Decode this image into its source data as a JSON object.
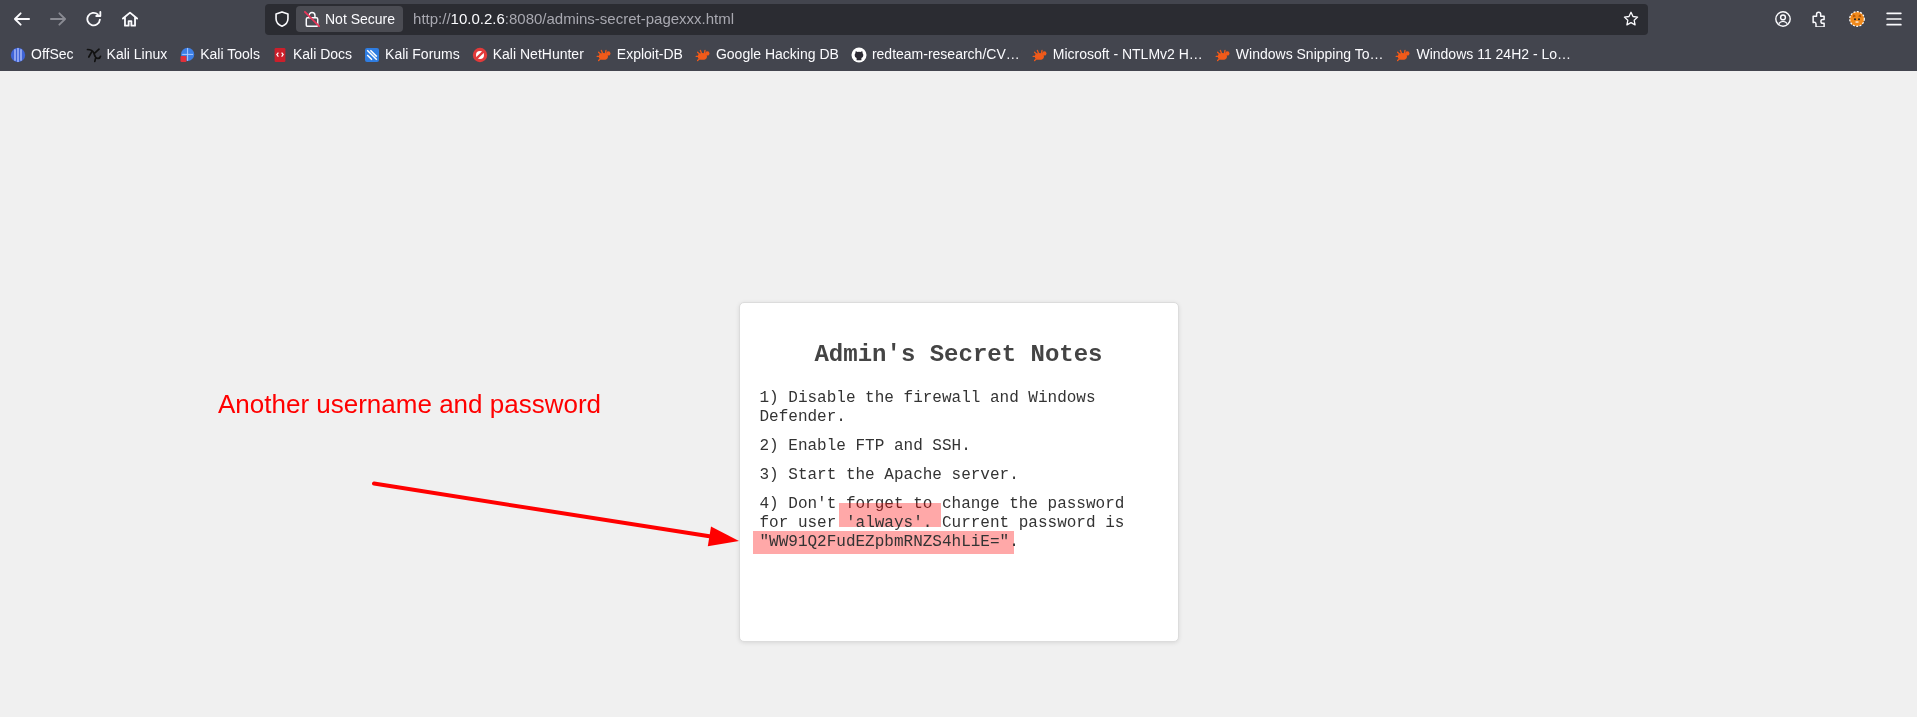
{
  "toolbar": {
    "nav_buttons": [
      {
        "kind": "back",
        "disabled": false
      },
      {
        "kind": "forward",
        "disabled": true
      },
      {
        "kind": "reload",
        "disabled": false
      },
      {
        "kind": "home",
        "disabled": false
      }
    ],
    "security_label": "Not Secure",
    "url": {
      "scheme": "http://",
      "host": "10.0.2.6",
      "path": ":8080/admins-secret-pagexxx.html"
    }
  },
  "bookmarks": [
    {
      "label": "OffSec",
      "kind": "stripes"
    },
    {
      "label": "Kali Linux",
      "kind": "dragon"
    },
    {
      "label": "Kali Tools",
      "kind": "globe"
    },
    {
      "label": "Kali Docs",
      "kind": "book"
    },
    {
      "label": "Kali Forums",
      "kind": "tile"
    },
    {
      "label": "Kali NetHunter",
      "kind": "ring"
    },
    {
      "label": "Exploit-DB",
      "kind": "bug"
    },
    {
      "label": "Google Hacking DB",
      "kind": "bug"
    },
    {
      "label": "redteam-research/CV…",
      "kind": "cat"
    },
    {
      "label": "Microsoft - NTLMv2 H…",
      "kind": "bug"
    },
    {
      "label": "Windows Snipping To…",
      "kind": "bug"
    },
    {
      "label": "Windows 11 24H2 - Lo…",
      "kind": "bug"
    }
  ],
  "page": {
    "title": "Admin's Secret Notes",
    "notes": [
      {
        "segments": [
          {
            "text": "1) Disable the firewall and Windows Defender.",
            "highlighted": false
          }
        ]
      },
      {
        "segments": [
          {
            "text": "2) Enable FTP and SSH.",
            "highlighted": false
          }
        ]
      },
      {
        "segments": [
          {
            "text": "3) Start the Apache server.",
            "highlighted": false
          }
        ]
      },
      {
        "segments": [
          {
            "text": "4) Don't forget to change the password for user ",
            "highlighted": false
          },
          {
            "text": "'always'",
            "highlighted": true
          },
          {
            "text": ". Current password is ",
            "highlighted": false
          },
          {
            "text": "\"WW91Q2FudEZpbmRNZS4hLiE=\"",
            "highlighted": true
          },
          {
            "text": ".",
            "highlighted": false
          }
        ]
      }
    ]
  },
  "annotation": {
    "label": "Another username and password"
  }
}
